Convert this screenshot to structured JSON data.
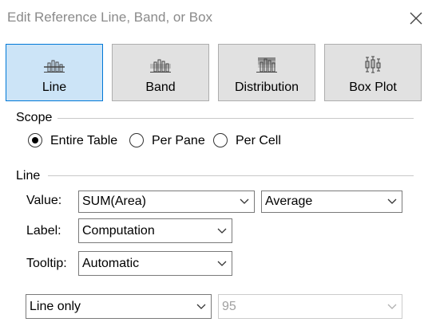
{
  "dialog": {
    "title": "Edit Reference Line, Band, or Box",
    "close_icon": "close-icon"
  },
  "types": [
    {
      "label": "Line",
      "icon": "line-chart-icon",
      "selected": true
    },
    {
      "label": "Band",
      "icon": "band-chart-icon",
      "selected": false
    },
    {
      "label": "Distribution",
      "icon": "distribution-chart-icon",
      "selected": false
    },
    {
      "label": "Box Plot",
      "icon": "box-plot-icon",
      "selected": false
    }
  ],
  "scope": {
    "heading": "Scope",
    "options": [
      {
        "label": "Entire Table",
        "checked": true
      },
      {
        "label": "Per Pane",
        "checked": false
      },
      {
        "label": "Per Cell",
        "checked": false
      }
    ]
  },
  "line": {
    "heading": "Line",
    "value_label": "Value:",
    "value_field": "SUM(Area)",
    "value_aggregation": "Average",
    "label_label": "Label:",
    "label_value": "Computation",
    "tooltip_label": "Tooltip:",
    "tooltip_value": "Automatic",
    "line_option": "Line only",
    "confidence_value": "95"
  },
  "colors": {
    "selected_bg": "#cce4f7",
    "selected_border": "#0078d7",
    "button_bg": "#e1e1e1"
  }
}
